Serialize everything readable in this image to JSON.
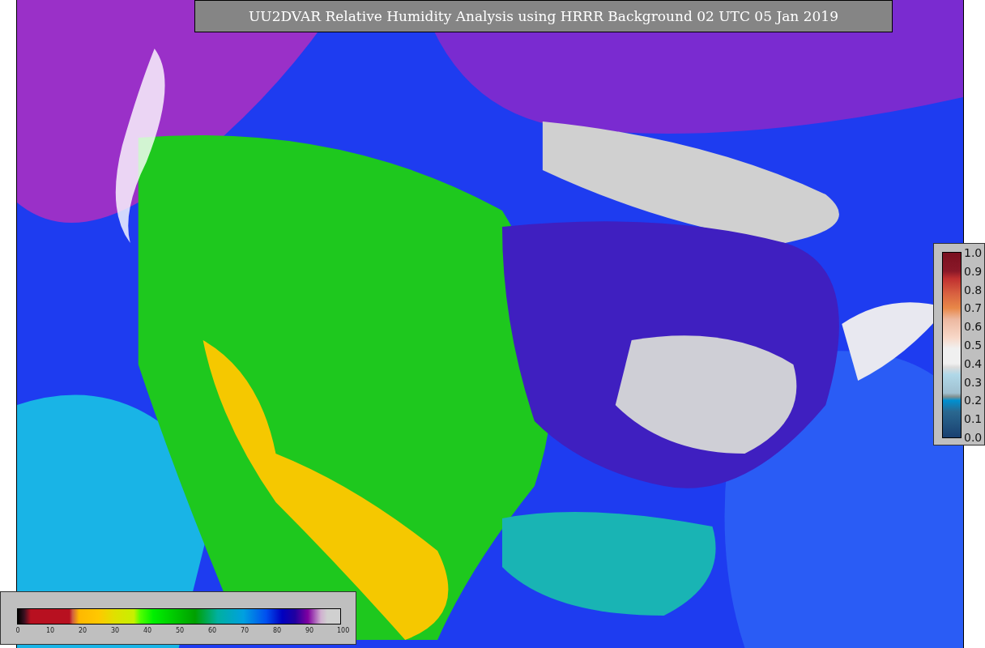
{
  "title": "UU2DVAR Relative Humidity Analysis using HRRR Background 02 UTC 05 Jan 2019",
  "bottom_colorbar": {
    "ticks": [
      "0",
      "10",
      "20",
      "30",
      "40",
      "50",
      "60",
      "70",
      "80",
      "90",
      "100"
    ]
  },
  "right_colorbar": {
    "ticks": [
      "1.0",
      "0.9",
      "0.8",
      "0.7",
      "0.6",
      "0.5",
      "0.4",
      "0.3",
      "0.2",
      "0.1",
      "0.0"
    ]
  }
}
